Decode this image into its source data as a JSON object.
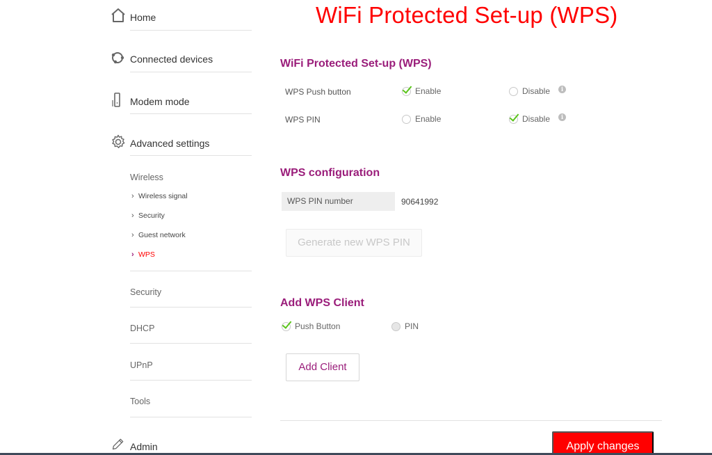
{
  "page": {
    "title": "WiFi Protected Set-up (WPS)"
  },
  "sidebar": {
    "main_items": [
      {
        "label": "Home",
        "icon": "home-icon"
      },
      {
        "label": "Connected devices",
        "icon": "connected-devices-icon"
      },
      {
        "label": "Modem mode",
        "icon": "modem-icon"
      },
      {
        "label": "Advanced settings",
        "icon": "gear-icon"
      }
    ],
    "wireless": {
      "heading": "Wireless",
      "items": [
        {
          "label": "Wireless signal",
          "active": false
        },
        {
          "label": "Security",
          "active": false
        },
        {
          "label": "Guest network",
          "active": false
        },
        {
          "label": "WPS",
          "active": true
        }
      ]
    },
    "advanced_items": [
      {
        "label": "Security"
      },
      {
        "label": "DHCP"
      },
      {
        "label": "UPnP"
      },
      {
        "label": "Tools"
      }
    ],
    "admin": {
      "label": "Admin",
      "icon": "pencil-icon"
    }
  },
  "wps": {
    "section_title": "WiFi Protected Set-up (WPS)",
    "rows": [
      {
        "label": "WPS Push button",
        "enable_label": "Enable",
        "disable_label": "Disable",
        "selected": "Enable"
      },
      {
        "label": "WPS PIN",
        "enable_label": "Enable",
        "disable_label": "Disable",
        "selected": "Disable"
      }
    ]
  },
  "config": {
    "section_title": "WPS configuration",
    "pin_label": "WPS PIN number",
    "pin_value": "90641992",
    "generate_button": "Generate new WPS PIN"
  },
  "client": {
    "section_title": "Add WPS Client",
    "options": [
      {
        "label": "Push Button",
        "selected": true
      },
      {
        "label": "PIN",
        "selected": false
      }
    ],
    "add_button": "Add Client"
  },
  "footer": {
    "apply_button": "Apply changes"
  },
  "colors": {
    "brand_red": "#ff0000",
    "heading_purple": "#9a1d7a",
    "check_green": "#5ac41b"
  }
}
